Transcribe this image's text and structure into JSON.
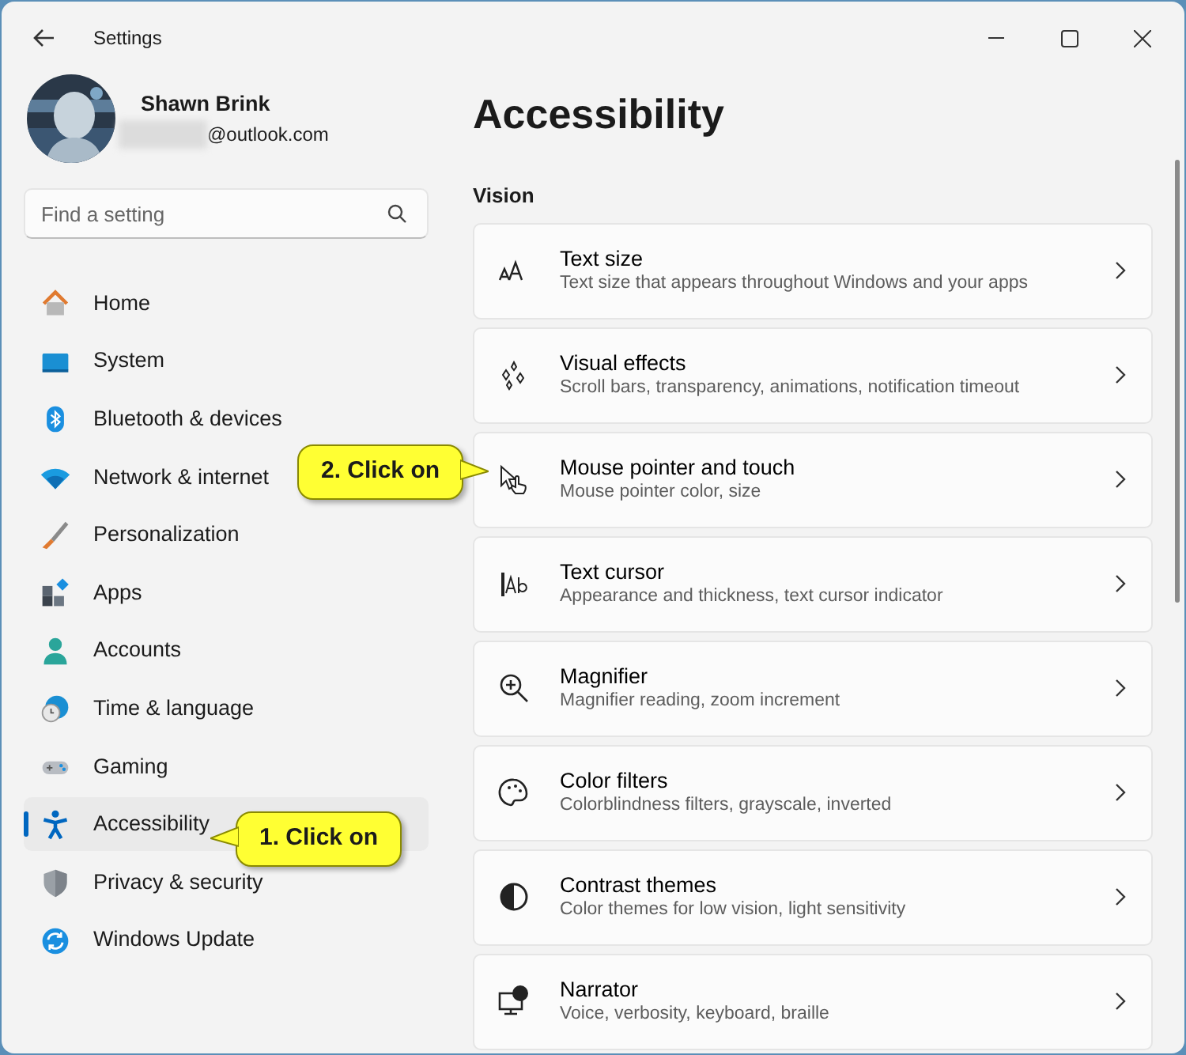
{
  "window": {
    "title": "Settings"
  },
  "account": {
    "name": "Shawn Brink",
    "email": "@outlook.com",
    "kind": "picture"
  },
  "search": {
    "placeholder": "Find a setting"
  },
  "sidebar": {
    "items": [
      {
        "label": "Home",
        "selected": false
      },
      {
        "label": "System",
        "selected": false
      },
      {
        "label": "Bluetooth & devices",
        "selected": false
      },
      {
        "label": "Network & internet",
        "selected": false
      },
      {
        "label": "Personalization",
        "selected": false
      },
      {
        "label": "Apps",
        "selected": false
      },
      {
        "label": "Accounts",
        "selected": false
      },
      {
        "label": "Time & language",
        "selected": false
      },
      {
        "label": "Gaming",
        "selected": false
      },
      {
        "label": "Accessibility",
        "selected": true
      },
      {
        "label": "Privacy & security",
        "selected": false
      },
      {
        "label": "Windows Update",
        "selected": false
      }
    ]
  },
  "page": {
    "title": "Accessibility",
    "section": "Vision",
    "items": [
      {
        "title": "Text size",
        "subtitle": "Text size that appears throughout Windows and your apps"
      },
      {
        "title": "Visual effects",
        "subtitle": "Scroll bars, transparency, animations, notification timeout"
      },
      {
        "title": "Mouse pointer and touch",
        "subtitle": "Mouse pointer color, size"
      },
      {
        "title": "Text cursor",
        "subtitle": "Appearance and thickness, text cursor indicator"
      },
      {
        "title": "Magnifier",
        "subtitle": "Magnifier reading, zoom increment"
      },
      {
        "title": "Color filters",
        "subtitle": "Colorblindness filters, grayscale, inverted"
      },
      {
        "title": "Contrast themes",
        "subtitle": "Color themes for low vision, light sensitivity"
      },
      {
        "title": "Narrator",
        "subtitle": "Voice, verbosity, keyboard, braille"
      }
    ]
  },
  "callouts": [
    {
      "text": "1. Click on"
    },
    {
      "text": "2. Click on"
    }
  ]
}
